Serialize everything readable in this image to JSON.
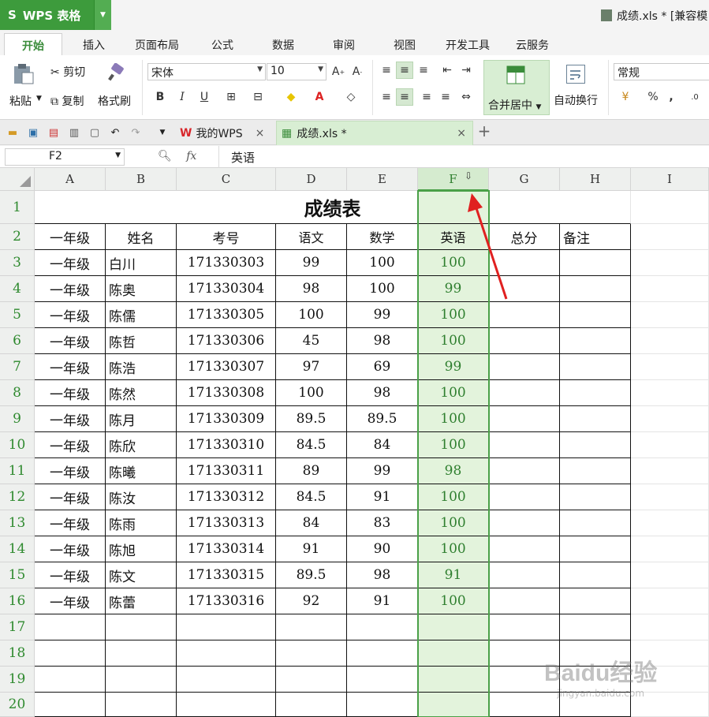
{
  "app": {
    "logo": "S",
    "name": "WPS 表格"
  },
  "document": {
    "title": "成绩.xls * [兼容模"
  },
  "menu_tabs": [
    "开始",
    "插入",
    "页面布局",
    "公式",
    "数据",
    "审阅",
    "视图",
    "开发工具",
    "云服务"
  ],
  "ribbon": {
    "paste": "粘贴",
    "cut": "剪切",
    "copy": "复制",
    "format_painter": "格式刷",
    "font_name": "宋体",
    "font_size": "10",
    "merge_center": "合并居中",
    "wrap_text": "自动换行",
    "number_format": "常规"
  },
  "doc_tabs": [
    {
      "label": "我的WPS"
    },
    {
      "label": "成绩.xls *"
    }
  ],
  "formula_bar": {
    "name_box": "F2",
    "fx": "fx",
    "value": "英语"
  },
  "sheet": {
    "columns": [
      "A",
      "B",
      "C",
      "D",
      "E",
      "F",
      "G",
      "H",
      "I"
    ],
    "rows": [
      "1",
      "2",
      "3",
      "4",
      "5",
      "6",
      "7",
      "8",
      "9",
      "10",
      "11",
      "12",
      "13",
      "14",
      "15",
      "16",
      "17",
      "18",
      "19",
      "20"
    ],
    "title": "成绩表",
    "headers": [
      "一年级",
      "姓名",
      "考号",
      "语文",
      "数学",
      "英语",
      "总分",
      "备注"
    ],
    "data": [
      [
        "一年级",
        "白川",
        "171330303",
        "99",
        "100",
        "100"
      ],
      [
        "一年级",
        "陈奥",
        "171330304",
        "98",
        "100",
        "99"
      ],
      [
        "一年级",
        "陈儒",
        "171330305",
        "100",
        "99",
        "100"
      ],
      [
        "一年级",
        "陈哲",
        "171330306",
        "45",
        "98",
        "100"
      ],
      [
        "一年级",
        "陈浩",
        "171330307",
        "97",
        "69",
        "99"
      ],
      [
        "一年级",
        "陈然",
        "171330308",
        "100",
        "98",
        "100"
      ],
      [
        "一年级",
        "陈月",
        "171330309",
        "89.5",
        "89.5",
        "100"
      ],
      [
        "一年级",
        "陈欣",
        "171330310",
        "84.5",
        "84",
        "100"
      ],
      [
        "一年级",
        "陈曦",
        "171330311",
        "89",
        "99",
        "98"
      ],
      [
        "一年级",
        "陈汝",
        "171330312",
        "84.5",
        "91",
        "100"
      ],
      [
        "一年级",
        "陈雨",
        "171330313",
        "84",
        "83",
        "100"
      ],
      [
        "一年级",
        "陈旭",
        "171330314",
        "91",
        "90",
        "100"
      ],
      [
        "一年级",
        "陈文",
        "171330315",
        "89.5",
        "98",
        "91"
      ],
      [
        "一年级",
        "陈蕾",
        "171330316",
        "92",
        "91",
        "100"
      ]
    ]
  },
  "watermark": {
    "brand": "Baidu经验",
    "url": "jingyan.baidu.com"
  },
  "colors": {
    "accent": "#3d9b3c",
    "selection": "#e3f3dc",
    "arrow": "#e02020"
  }
}
